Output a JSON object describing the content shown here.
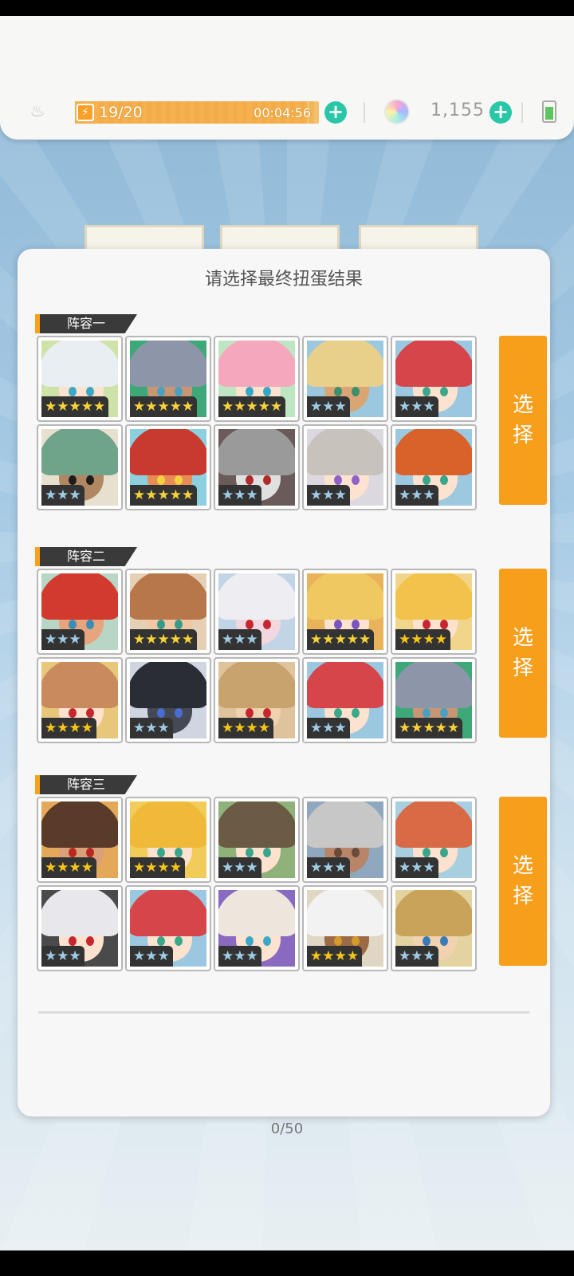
{
  "status": {
    "stamina_value": "19/20",
    "stamina_progress": 0.95,
    "stamina_timer": "00:04:56",
    "gems_value": "1,155",
    "bell_icon": "bell-icon",
    "bolt_icon": "lightning-bolt-icon",
    "gem_icon": "rainbow-gem-icon",
    "battery_icon": "battery-icon",
    "plus_icon": "plus-icon"
  },
  "modal": {
    "title": "请选择最终扭蛋结果",
    "select_label_1": "选",
    "select_label_2": "择"
  },
  "teams": [
    {
      "name": "阵容一",
      "characters": [
        {
          "stars": "★★★★★",
          "rarity": 5
        },
        {
          "stars": "★★★★★",
          "rarity": 5
        },
        {
          "stars": "★★★★★",
          "rarity": 5
        },
        {
          "stars": "★★★",
          "rarity": 3
        },
        {
          "stars": "★★★",
          "rarity": 3
        },
        {
          "stars": "★★★",
          "rarity": 3
        },
        {
          "stars": "★★★★★",
          "rarity": 5
        },
        {
          "stars": "★★★",
          "rarity": 3
        },
        {
          "stars": "★★★",
          "rarity": 3
        },
        {
          "stars": "★★★",
          "rarity": 3
        }
      ]
    },
    {
      "name": "阵容二",
      "characters": [
        {
          "stars": "★★★",
          "rarity": 3
        },
        {
          "stars": "★★★★★",
          "rarity": 5
        },
        {
          "stars": "★★★",
          "rarity": 3
        },
        {
          "stars": "★★★★★",
          "rarity": 5
        },
        {
          "stars": "★★★★",
          "rarity": 4
        },
        {
          "stars": "★★★★",
          "rarity": 4
        },
        {
          "stars": "★★★",
          "rarity": 3
        },
        {
          "stars": "★★★★",
          "rarity": 4
        },
        {
          "stars": "★★★",
          "rarity": 3
        },
        {
          "stars": "★★★★★",
          "rarity": 5
        }
      ]
    },
    {
      "name": "阵容三",
      "characters": [
        {
          "stars": "★★★★",
          "rarity": 4
        },
        {
          "stars": "★★★★",
          "rarity": 4
        },
        {
          "stars": "★★★",
          "rarity": 3
        },
        {
          "stars": "★★★",
          "rarity": 3
        },
        {
          "stars": "★★★",
          "rarity": 3
        },
        {
          "stars": "★★★",
          "rarity": 3
        },
        {
          "stars": "★★★",
          "rarity": 3
        },
        {
          "stars": "★★★",
          "rarity": 3
        },
        {
          "stars": "★★★★",
          "rarity": 4
        },
        {
          "stars": "★★★",
          "rarity": 3
        }
      ]
    }
  ],
  "colors": {
    "accent": "#f79e1b",
    "teal_plus": "#29c6a8",
    "gold_star": "#f5c518",
    "blue_star": "#8ec7e8"
  },
  "footer": {
    "counter": "0/50"
  }
}
